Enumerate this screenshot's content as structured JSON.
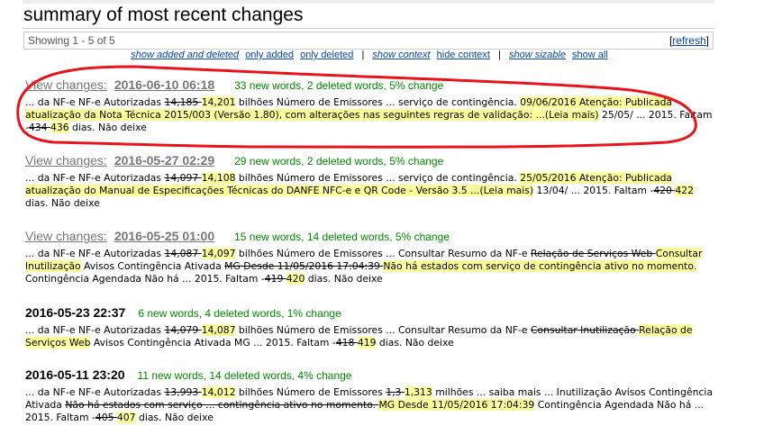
{
  "page_title": "summary of most recent changes",
  "showing": {
    "count": "Showing 1 - 5 of 5",
    "refresh_open": "[",
    "refresh": "refresh",
    "refresh_close": "]"
  },
  "filters": {
    "show_added_and_deleted": "show added and deleted",
    "only_added": "only added",
    "only_deleted": "only deleted",
    "sep": "|",
    "show_context": "show context",
    "hide_context": "hide context",
    "show_sizable": "show sizable",
    "show_all": "show all"
  },
  "annotation_color": "#e8141c",
  "entries": [
    {
      "link": true,
      "prefix": "View changes:",
      "date": "2016-06-10 06:18",
      "stats": "33 new words, 2 deleted words, 5% change",
      "segments": [
        {
          "t": "... da NF-e NF-e Autorizadas ",
          "k": "plain"
        },
        {
          "t": "14,185 ",
          "k": "del"
        },
        {
          "t": "14,201",
          "k": "add"
        },
        {
          "t": " bilhões Número de Emissores ... serviço de contingência. ",
          "k": "plain"
        },
        {
          "t": "09/06/2016 Atenção: Publicada atualização da Nota Técnica 2015/003 (Versão 1.80), com alterações nas seguintes regras de validação: ...(Leia mais)",
          "k": "add"
        },
        {
          "t": " 25/05/ ... 2015. Faltam -",
          "k": "plain"
        },
        {
          "t": "434 ",
          "k": "del"
        },
        {
          "t": "436",
          "k": "add"
        },
        {
          "t": " dias. Não deixe",
          "k": "plain"
        }
      ]
    },
    {
      "link": true,
      "prefix": "View changes:",
      "date": "2016-05-27 02:29",
      "stats": "29 new words, 2 deleted words, 5% change",
      "segments": [
        {
          "t": "... da NF-e NF-e Autorizadas ",
          "k": "plain"
        },
        {
          "t": "14,097 ",
          "k": "del"
        },
        {
          "t": "14,108",
          "k": "add"
        },
        {
          "t": " bilhões Número de Emissores ... serviço de contingência. ",
          "k": "plain"
        },
        {
          "t": "25/05/2016 Atenção: Publicada atualização do Manual de Especificações Técnicas do DANFE NFC-e e QR Code - Versão 3.5 ...(Leia mais)",
          "k": "add"
        },
        {
          "t": " 13/04/ ... 2015. Faltam -",
          "k": "plain"
        },
        {
          "t": "420 ",
          "k": "del"
        },
        {
          "t": "422",
          "k": "add"
        },
        {
          "t": " dias. Não deixe",
          "k": "plain"
        }
      ]
    },
    {
      "link": true,
      "prefix": "View changes:",
      "date": "2016-05-25 01:00",
      "stats": "15 new words, 14 deleted words, 5% change",
      "segments": [
        {
          "t": "... da NF-e NF-e Autorizadas ",
          "k": "plain"
        },
        {
          "t": "14,087 ",
          "k": "del"
        },
        {
          "t": "14,097",
          "k": "add"
        },
        {
          "t": " bilhões Número de Emissores ... Consultar Resumo da NF-e ",
          "k": "plain"
        },
        {
          "t": "Relação de Serviços Web ",
          "k": "del"
        },
        {
          "t": "Consultar Inutilização",
          "k": "add"
        },
        {
          "t": " Avisos Contingência Ativada ",
          "k": "plain"
        },
        {
          "t": "MG Desde 11/05/2016 17:04:39 ",
          "k": "del"
        },
        {
          "t": "Não há estados com serviço de contingência ativo no momento.",
          "k": "add"
        },
        {
          "t": " Contingência Agendada Não há ... 2015. Faltam -",
          "k": "plain"
        },
        {
          "t": "419 ",
          "k": "del"
        },
        {
          "t": "420",
          "k": "add"
        },
        {
          "t": " dias. Não deixe",
          "k": "plain"
        }
      ]
    },
    {
      "link": false,
      "prefix": "",
      "date": "2016-05-23 22:37",
      "stats": "6 new words, 4 deleted words, 1% change",
      "segments": [
        {
          "t": "... da NF-e NF-e Autorizadas ",
          "k": "plain"
        },
        {
          "t": "14,079 ",
          "k": "del"
        },
        {
          "t": "14,087",
          "k": "add"
        },
        {
          "t": " bilhões Número de Emissores ... Consultar Resumo da NF-e ",
          "k": "plain"
        },
        {
          "t": "Consultar Inutilização ",
          "k": "del"
        },
        {
          "t": "Relação de Serviços Web",
          "k": "add"
        },
        {
          "t": " Avisos Contingência Ativada MG ... 2015. Faltam -",
          "k": "plain"
        },
        {
          "t": "418 ",
          "k": "del"
        },
        {
          "t": "419",
          "k": "add"
        },
        {
          "t": " dias. Não deixe",
          "k": "plain"
        }
      ]
    },
    {
      "link": false,
      "prefix": "",
      "date": "2016-05-11 23:20",
      "stats": "11 new words, 14 deleted words, 4% change",
      "segments": [
        {
          "t": "... da NF-e NF-e Autorizadas ",
          "k": "plain"
        },
        {
          "t": "13,993 ",
          "k": "del"
        },
        {
          "t": "14,012",
          "k": "add"
        },
        {
          "t": " bilhões Número de Emissores ",
          "k": "plain"
        },
        {
          "t": "1,3 ",
          "k": "del"
        },
        {
          "t": "1,313",
          "k": "add"
        },
        {
          "t": " milhões ... saiba mais ... Inutilização Avisos Contingência Ativada ",
          "k": "plain"
        },
        {
          "t": "Não há estados com serviço ... contingência ativo no momento. ",
          "k": "del"
        },
        {
          "t": "MG Desde 11/05/2016 17:04:39",
          "k": "add"
        },
        {
          "t": " Contingência Agendada Não há ... 2015. Faltam -",
          "k": "plain"
        },
        {
          "t": "405 ",
          "k": "del"
        },
        {
          "t": "407",
          "k": "add"
        },
        {
          "t": " dias. Não deixe",
          "k": "plain"
        }
      ]
    }
  ]
}
